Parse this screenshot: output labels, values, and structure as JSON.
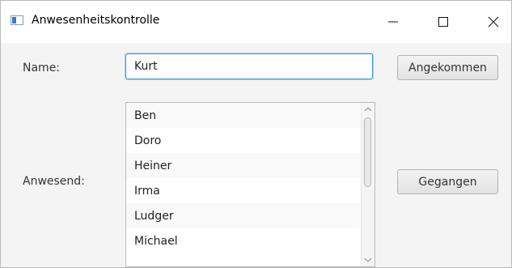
{
  "window": {
    "title": "Anwesenheitskontrolle",
    "icon": "app-window-icon",
    "controls": [
      "minimize-icon",
      "maximize-icon",
      "close-icon"
    ]
  },
  "form": {
    "name_label": "Name:",
    "name_value": "Kurt",
    "arrived_button": "Angekommen",
    "present_label": "Anwesend:",
    "left_button": "Gegangen"
  },
  "present_list": {
    "items": [
      "Ben",
      "Doro",
      "Heiner",
      "Irma",
      "Ludger",
      "Michael"
    ]
  },
  "colors": {
    "focus_border": "#3a98d8",
    "window_bg": "#f4f4f4"
  }
}
